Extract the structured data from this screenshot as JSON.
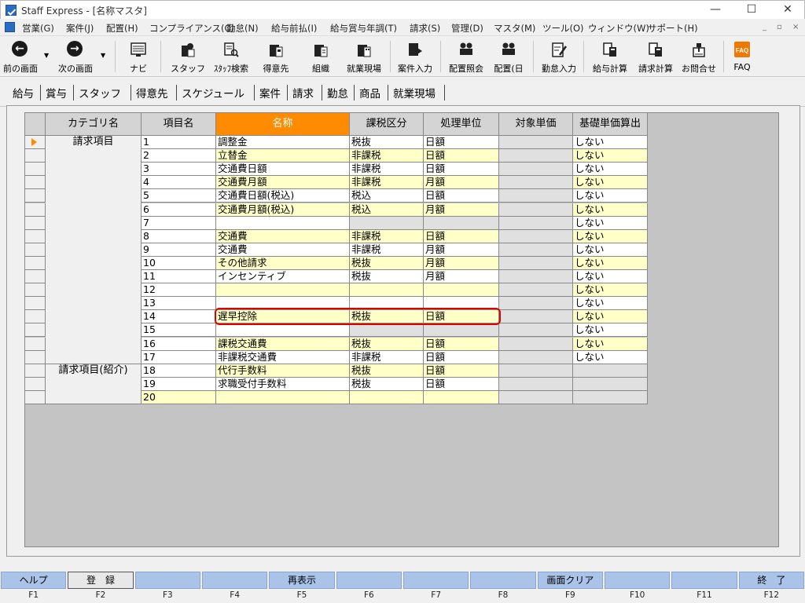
{
  "window": {
    "title": "Staff Express - [名称マスタ]",
    "controls": [
      "—",
      "☐",
      "✕"
    ]
  },
  "menu": [
    "営業(G)",
    "案件(J)",
    "配置(H)",
    "コンプライアンス(C)",
    "勤怠(N)",
    "給与前払(I)",
    "給与賞与年調(T)",
    "請求(S)",
    "管理(D)",
    "マスタ(M)",
    "ツール(O)",
    "ウィンドウ(W)",
    "サポート(H)"
  ],
  "mdi_controls": [
    "_",
    "▫",
    "×"
  ],
  "toolbar": {
    "back": "前の画面",
    "forward": "次の画面",
    "buttons": [
      {
        "label": "ナビ",
        "icon": "navi-icon"
      },
      {
        "label": "スタッフ",
        "icon": "staff-icon"
      },
      {
        "label": "ｽﾀｯﾌ検索",
        "icon": "staff-search-icon"
      },
      {
        "label": "得意先",
        "icon": "client-icon"
      },
      {
        "label": "組織",
        "icon": "organization-icon"
      },
      {
        "label": "就業現場",
        "icon": "worksite-icon"
      },
      {
        "label": "案件入力",
        "icon": "project-input-icon"
      },
      {
        "label": "配置照会",
        "icon": "placement-query-icon"
      },
      {
        "label": "配置(日",
        "icon": "placement-daily-icon"
      },
      {
        "label": "勤怠入力",
        "icon": "attendance-input-icon"
      },
      {
        "label": "給与計算",
        "icon": "payroll-icon"
      },
      {
        "label": "請求計算",
        "icon": "billing-calc-icon"
      },
      {
        "label": "お問合せ",
        "icon": "inquiry-icon"
      },
      {
        "label": "FAQ",
        "icon": "faq-icon"
      }
    ]
  },
  "tabs": [
    "給与",
    "賞与",
    "スタッフ",
    "得意先",
    "スケジュール",
    "案件",
    "請求",
    "勤怠",
    "商品",
    "就業現場"
  ],
  "active_tab": "請求",
  "grid": {
    "headers": [
      "カテゴリ名",
      "項目名",
      "名称",
      "課税区分",
      "処理単位",
      "対象単価",
      "基礎単価算出"
    ],
    "categories": [
      {
        "label": "請求項目",
        "rows": 17
      },
      {
        "label": "請求項目(紹介)",
        "rows": 3
      }
    ],
    "rows": [
      {
        "no": "1",
        "name": "調整金",
        "tax": "税抜",
        "unit": "日額",
        "calc": "しない"
      },
      {
        "no": "2",
        "name": "立替金",
        "tax": "非課税",
        "unit": "日額",
        "calc": "しない"
      },
      {
        "no": "3",
        "name": "交通費日額",
        "tax": "非課税",
        "unit": "日額",
        "calc": "しない"
      },
      {
        "no": "4",
        "name": "交通費月額",
        "tax": "非課税",
        "unit": "月額",
        "calc": "しない"
      },
      {
        "no": "5",
        "name": "交通費日額(税込)",
        "tax": "税込",
        "unit": "日額",
        "calc": "しない"
      },
      {
        "no": "6",
        "name": "交通費月額(税込)",
        "tax": "税込",
        "unit": "月額",
        "calc": "しない"
      },
      {
        "no": "7",
        "name": "",
        "tax": "",
        "unit": "",
        "calc": "しない"
      },
      {
        "no": "8",
        "name": "交通費",
        "tax": "非課税",
        "unit": "日額",
        "calc": "しない"
      },
      {
        "no": "9",
        "name": "交通費",
        "tax": "非課税",
        "unit": "月額",
        "calc": "しない"
      },
      {
        "no": "10",
        "name": "その他請求",
        "tax": "税抜",
        "unit": "月額",
        "calc": "しない"
      },
      {
        "no": "11",
        "name": "インセンティブ",
        "tax": "税抜",
        "unit": "月額",
        "calc": "しない"
      },
      {
        "no": "12",
        "name": "",
        "tax": "",
        "unit": "",
        "calc": "しない"
      },
      {
        "no": "13",
        "name": "",
        "tax": "",
        "unit": "",
        "calc": "しない"
      },
      {
        "no": "14",
        "name": "遅早控除",
        "tax": "税抜",
        "unit": "日額",
        "calc": "しない"
      },
      {
        "no": "15",
        "name": "",
        "tax": "",
        "unit": "",
        "calc": "しない"
      },
      {
        "no": "16",
        "name": "課税交通費",
        "tax": "税抜",
        "unit": "日額",
        "calc": "しない"
      },
      {
        "no": "17",
        "name": "非課税交通費",
        "tax": "非課税",
        "unit": "日額",
        "calc": "しない"
      },
      {
        "no": "18",
        "name": "代行手数料",
        "tax": "税抜",
        "unit": "日額",
        "calc": ""
      },
      {
        "no": "19",
        "name": "求職受付手数料",
        "tax": "税抜",
        "unit": "日額",
        "calc": ""
      },
      {
        "no": "20",
        "name": "",
        "tax": "",
        "unit": "",
        "calc": ""
      }
    ]
  },
  "fkeys": [
    {
      "label": "ヘルプ",
      "key": "F1"
    },
    {
      "label": "登　録",
      "key": "F2"
    },
    {
      "label": "",
      "key": "F3"
    },
    {
      "label": "",
      "key": "F4"
    },
    {
      "label": "再表示",
      "key": "F5"
    },
    {
      "label": "",
      "key": "F6"
    },
    {
      "label": "",
      "key": "F7"
    },
    {
      "label": "",
      "key": "F8"
    },
    {
      "label": "画面クリア",
      "key": "F9"
    },
    {
      "label": "",
      "key": "F10"
    },
    {
      "label": "",
      "key": "F11"
    },
    {
      "label": "終　了",
      "key": "F12"
    }
  ],
  "colors": {
    "active_header": "#ff8c00",
    "row_yellow": "#ffffc8",
    "highlight_border": "#e00000",
    "fkey_button": "#a9c4e8"
  }
}
